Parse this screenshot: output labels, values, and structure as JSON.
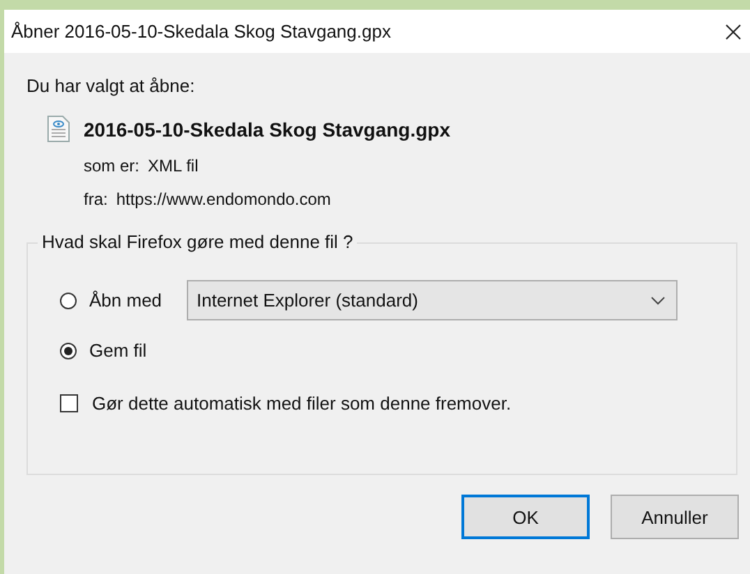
{
  "window": {
    "title": "Åbner 2016-05-10-Skedala Skog Stavgang.gpx"
  },
  "intro": "Du har valgt at åbne:",
  "file": {
    "name": "2016-05-10-Skedala Skog Stavgang.gpx",
    "type_label": "som er:",
    "type": "XML fil",
    "source_label": "fra:",
    "source": "https://www.endomondo.com"
  },
  "group": {
    "legend": "Hvad skal Firefox gøre med denne fil ?",
    "options": [
      {
        "label": "Åbn med",
        "selected": false,
        "app": "Internet Explorer (standard)"
      },
      {
        "label": "Gem fil",
        "selected": true
      }
    ],
    "remember": {
      "label": "Gør dette automatisk med filer som denne fremover.",
      "checked": false
    }
  },
  "buttons": [
    {
      "label": "OK",
      "default": true
    },
    {
      "label": "Annuller",
      "default": false
    }
  ]
}
